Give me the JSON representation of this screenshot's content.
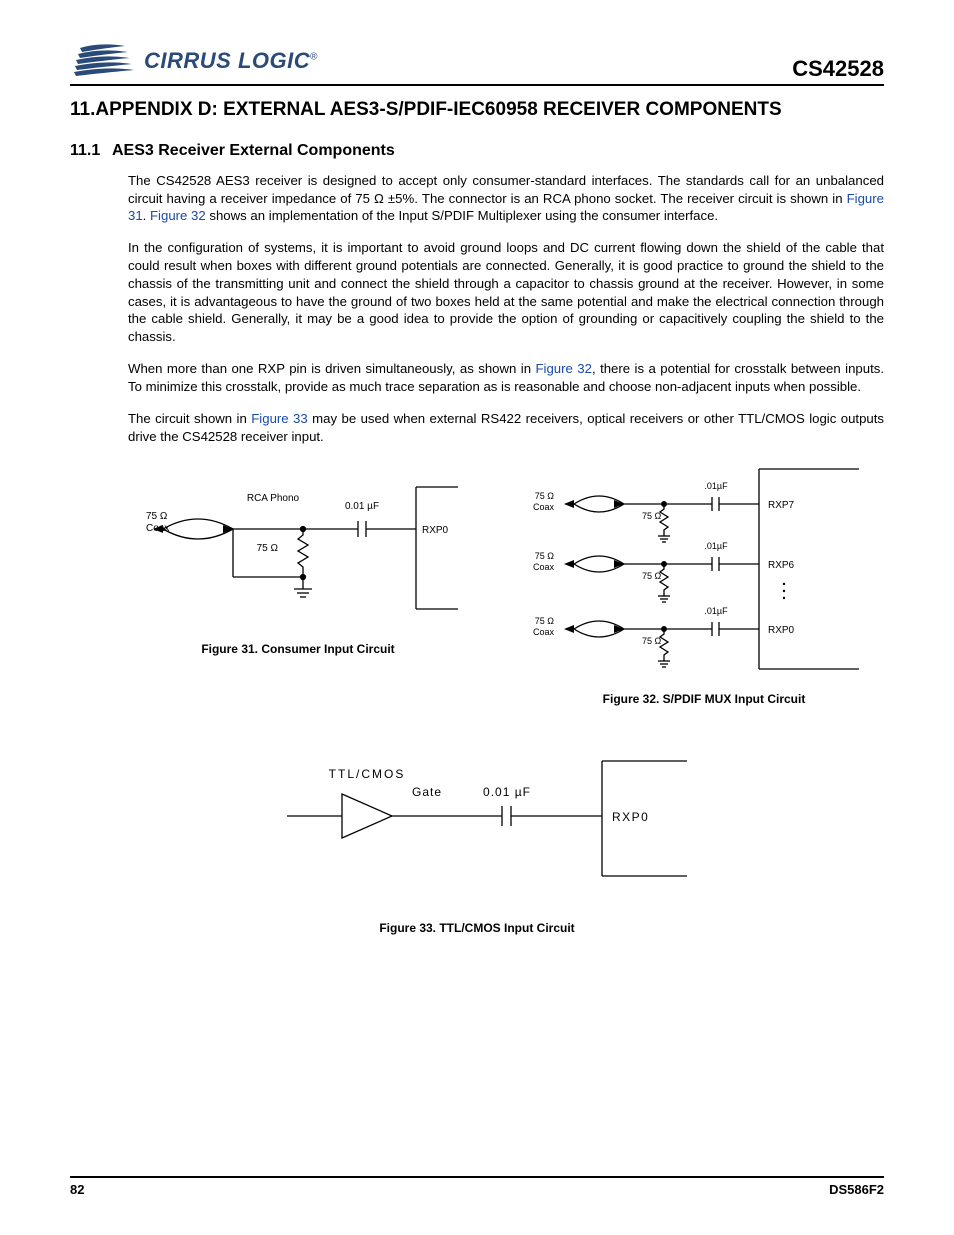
{
  "header": {
    "logo_text": "CIRRUS LOGIC",
    "part_number": "CS42528"
  },
  "section": {
    "number": "11.",
    "title": "APPENDIX D: EXTERNAL AES3-S/PDIF-IEC60958 RECEIVER COMPONENTS"
  },
  "subsection": {
    "number": "11.1",
    "title": "AES3 Receiver External Components"
  },
  "paragraphs": {
    "p1a": "The CS42528 AES3 receiver is designed to accept only consumer-standard interfaces. The standards call for an unbalanced circuit having a receiver impedance of 75 Ω ±5%. The connector is an RCA phono socket. The receiver circuit is shown in ",
    "p1_link1": "Figure 31",
    "p1b": ". ",
    "p1_link2": "Figure 32",
    "p1c": " shows an implementation of the Input S/PDIF Multiplexer using the consumer interface.",
    "p2": "In the configuration of systems, it is important to avoid ground loops and DC current flowing down the shield of the cable that could result when boxes with different ground potentials are connected. Generally, it is good practice to ground the shield to the chassis of the transmitting unit and connect the shield through a capacitor to chassis ground at the receiver. However, in some cases, it is advantageous to have the ground of two boxes held at the same potential and make the electrical connection through the cable shield. Generally, it may be a good idea to provide the option of grounding or capacitively coupling the shield to the chassis.",
    "p3a": "When more than one RXP pin is driven simultaneously, as shown in ",
    "p3_link1": "Figure 32",
    "p3b": ", there is a potential for crosstalk between inputs. To minimize this crosstalk, provide as much trace separation as is reasonable and choose non-adjacent inputs when possible.",
    "p4a": "The circuit shown in ",
    "p4_link1": "Figure 33",
    "p4b": " may be used when external RS422 receivers, optical receivers or other TTL/CMOS logic outputs drive the CS42528 receiver input."
  },
  "figures": {
    "fig31": {
      "caption": "Figure 31.  Consumer Input Circuit",
      "labels": {
        "impedance_coax": "75 Ω",
        "coax": "Coax",
        "rca": "RCA Phono",
        "r": "75 Ω",
        "cap": "0.01 µF",
        "out": "RXP0"
      }
    },
    "fig32": {
      "caption": "Figure 32.  S/PDIF MUX Input Circuit",
      "labels": {
        "impedance_coax": "75 Ω",
        "coax": "Coax",
        "r": "75 Ω",
        "cap": ".01µF",
        "out7": "RXP7",
        "out6": "RXP6",
        "out0": "RXP0"
      }
    },
    "fig33": {
      "caption": "Figure 33.  TTL/CMOS Input Circuit",
      "labels": {
        "gate_top": "TTL/CMOS",
        "gate": "Gate",
        "cap": "0.01 µF",
        "out": "RXP0"
      }
    }
  },
  "footer": {
    "page": "82",
    "doc": "DS586F2"
  }
}
